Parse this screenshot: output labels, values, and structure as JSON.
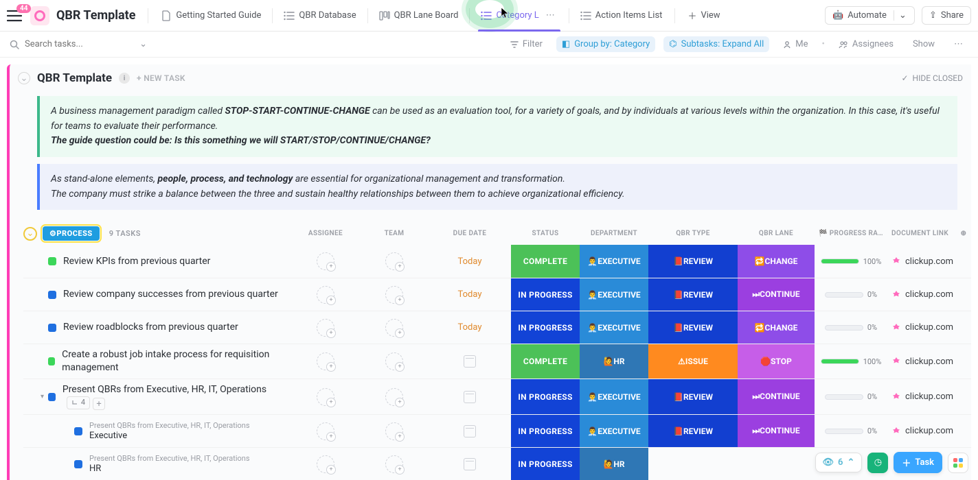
{
  "badge": "44",
  "title": "QBR Template",
  "tabs": [
    {
      "label": "Getting Started Guide",
      "icon": "doc"
    },
    {
      "label": "QBR Database",
      "icon": "list"
    },
    {
      "label": "QBR Lane Board",
      "icon": "board"
    },
    {
      "label": "Category L",
      "icon": "list",
      "active": true
    },
    {
      "label": "Action Items List",
      "icon": "list"
    }
  ],
  "add_view": "View",
  "top_right": {
    "automate": "Automate",
    "share": "Share"
  },
  "toolbar": {
    "search_placeholder": "Search tasks...",
    "filter": "Filter",
    "group_by": "Group by: Category",
    "subtasks": "Subtasks: Expand All",
    "me": "Me",
    "assignees": "Assignees",
    "show": "Show"
  },
  "list": {
    "title": "QBR Template",
    "new_task": "+ NEW TASK",
    "hide_closed": "HIDE CLOSED",
    "callout_green_pre": "A business management paradigm called ",
    "callout_green_bold": "STOP-START-CONTINUE-CHANGE",
    "callout_green_post": " can be used as an evaluation tool, for a variety of goals, and by individuals at various levels within the organization. In this case, it's useful for teams to evaluate their performance.",
    "callout_green_line2": "The guide question could be: Is this something we will START/STOP/CONTINUE/CHANGE?",
    "callout_blue_pre": "As stand-alone elements, ",
    "callout_blue_bold": "people, process, and technology",
    "callout_blue_post": " are essential for organizational management and transformation.",
    "callout_blue_line2": "The company must strike a balance between the three and sustain healthy relationships between them to achieve organizational efficiency."
  },
  "group": {
    "chip": "⚙PROCESS",
    "count": "9 TASKS",
    "columns": {
      "assignee": "ASSIGNEE",
      "team": "TEAM",
      "due": "DUE DATE",
      "status": "STATUS",
      "dept": "DEPARTMENT",
      "qtype": "QBR TYPE",
      "lane": "QBR LANE",
      "prog": "🏁 PROGRESS RA…",
      "doc": "DOCUMENT LINK"
    }
  },
  "tasks": [
    {
      "name": "Review KPIs from previous quarter",
      "due": "Today",
      "status": "COMPLETE",
      "statusCls": "bg-complete",
      "dept": "👨‍💼EXECUTIVE",
      "deptCls": "bg-exec",
      "qtype": "📕REVIEW",
      "qtypeCls": "bg-review",
      "lane": "🔁CHANGE",
      "laneCls": "bg-change",
      "prog": 100,
      "doc": "clickup.com",
      "sq": "sq-green"
    },
    {
      "name": "Review company successes from previous quarter",
      "due": "Today",
      "status": "IN PROGRESS",
      "statusCls": "bg-inprog",
      "dept": "👨‍💼EXECUTIVE",
      "deptCls": "bg-exec",
      "qtype": "📕REVIEW",
      "qtypeCls": "bg-review",
      "lane": "⏭CONTINUE",
      "laneCls": "bg-continue",
      "prog": 0,
      "doc": "clickup.com",
      "sq": "sq-blue"
    },
    {
      "name": "Review roadblocks from previous quarter",
      "due": "Today",
      "status": "IN PROGRESS",
      "statusCls": "bg-inprog",
      "dept": "👨‍💼EXECUTIVE",
      "deptCls": "bg-exec",
      "qtype": "📕REVIEW",
      "qtypeCls": "bg-review",
      "lane": "🔁CHANGE",
      "laneCls": "bg-change",
      "prog": 0,
      "doc": "clickup.com",
      "sq": "sq-blue"
    },
    {
      "name": "Create a robust job intake process for requisition management",
      "due": "",
      "status": "COMPLETE",
      "statusCls": "bg-complete",
      "dept": "🙋HR",
      "deptCls": "bg-hr",
      "qtype": "⚠ISSUE",
      "qtypeCls": "bg-issue",
      "lane": "🛑STOP",
      "laneCls": "bg-stop",
      "prog": 100,
      "doc": "clickup.com",
      "sq": "sq-green"
    },
    {
      "name": "Present QBRs from Executive, HR, IT, Operations",
      "due": "",
      "status": "IN PROGRESS",
      "statusCls": "bg-inprog",
      "dept": "👨‍💼EXECUTIVE",
      "deptCls": "bg-exec",
      "qtype": "📕REVIEW",
      "qtypeCls": "bg-review",
      "lane": "⏭CONTINUE",
      "laneCls": "bg-continue",
      "prog": 0,
      "doc": "clickup.com",
      "sq": "sq-blue",
      "expandable": true,
      "subcount": "4"
    },
    {
      "name": "Executive",
      "parent": "Present QBRs from Executive, HR, IT, Operations",
      "due": "",
      "status": "IN PROGRESS",
      "statusCls": "bg-inprog",
      "dept": "👨‍💼EXECUTIVE",
      "deptCls": "bg-exec",
      "qtype": "📕REVIEW",
      "qtypeCls": "bg-review",
      "lane": "⏭CONTINUE",
      "laneCls": "bg-continue",
      "prog": 0,
      "doc": "clickup.com",
      "sq": "sq-blue",
      "indent": 1
    },
    {
      "name": "HR",
      "parent": "Present QBRs from Executive, HR, IT, Operations",
      "due": "",
      "status": "IN PROGRESS",
      "statusCls": "bg-inprog",
      "dept": "🙋HR",
      "deptCls": "bg-hr",
      "qtype": "",
      "qtypeCls": "",
      "lane": "",
      "laneCls": "",
      "prog": null,
      "doc": "",
      "sq": "sq-blue",
      "indent": 1
    }
  ],
  "float": {
    "count": "6",
    "task_btn": "Task"
  }
}
